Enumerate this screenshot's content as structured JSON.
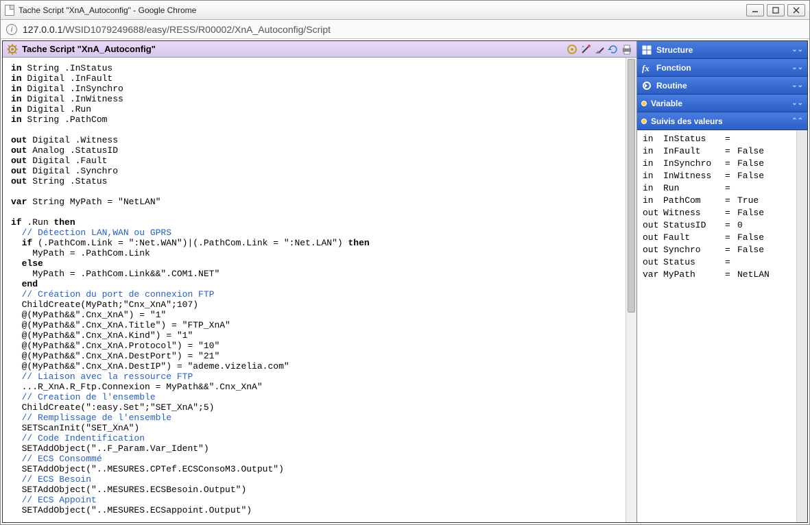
{
  "window": {
    "title": "Tache Script \"XnA_Autoconfig\" - Google Chrome"
  },
  "address": {
    "prefix": "127.0.0.1",
    "path": "/WSID1079249688/easy/RESS/R00002/XnA_Autoconfig/Script"
  },
  "header": {
    "title": "Tache Script \"XnA_Autoconfig\""
  },
  "accordion": {
    "structure": "Structure",
    "fonction": "Fonction",
    "routine": "Routine",
    "variable": "Variable",
    "suivis": "Suivis des valeurs"
  },
  "values": [
    {
      "kind": "in",
      "name": "InStatus",
      "val": ""
    },
    {
      "kind": "in",
      "name": "InFault",
      "val": "False"
    },
    {
      "kind": "in",
      "name": "InSynchro",
      "val": "False"
    },
    {
      "kind": "in",
      "name": "InWitness",
      "val": "False"
    },
    {
      "kind": "in",
      "name": "Run",
      "val": ""
    },
    {
      "kind": "in",
      "name": "PathCom",
      "val": "True"
    },
    {
      "kind": "out",
      "name": "Witness",
      "val": "False"
    },
    {
      "kind": "out",
      "name": "StatusID",
      "val": "0"
    },
    {
      "kind": "out",
      "name": "Fault",
      "val": "False"
    },
    {
      "kind": "out",
      "name": "Synchro",
      "val": "False"
    },
    {
      "kind": "out",
      "name": "Status",
      "val": ""
    },
    {
      "kind": "var",
      "name": "MyPath",
      "val": "NetLAN"
    }
  ],
  "code": {
    "l1a": "in",
    "l1b": " String .InStatus",
    "l2a": "in",
    "l2b": " Digital .InFault",
    "l3a": "in",
    "l3b": " Digital .InSynchro",
    "l4a": "in",
    "l4b": " Digital .InWitness",
    "l5a": "in",
    "l5b": " Digital .Run",
    "l6a": "in",
    "l6b": " String .PathCom",
    "blank1": "",
    "l7a": "out",
    "l7b": " Digital .Witness",
    "l8a": "out",
    "l8b": " Analog .StatusID",
    "l9a": "out",
    "l9b": " Digital .Fault",
    "l10a": "out",
    "l10b": " Digital .Synchro",
    "l11a": "out",
    "l11b": " String .Status",
    "blank2": "",
    "l12a": "var",
    "l12b": " String MyPath = \"NetLAN\"",
    "blank3": "",
    "l13a": "if",
    "l13b": " .Run ",
    "l13c": "then",
    "c1": "  // Détection LAN,WAN ou GPRS",
    "l14a": "  if",
    "l14b": " (.PathCom.Link = \":Net.WAN\")|(.PathCom.Link = \":Net.LAN\") ",
    "l14c": "then",
    "l15": "    MyPath = .PathCom.Link",
    "l16a": "  else",
    "l17": "    MyPath = .PathCom.Link&&\".COM1.NET\"",
    "l18a": "  end",
    "c2": "  // Création du port de connexion FTP",
    "l19": "  ChildCreate(MyPath;\"Cnx_XnA\";107)",
    "l20": "  @(MyPath&&\".Cnx_XnA\") = \"1\"",
    "l21": "  @(MyPath&&\".Cnx_XnA.Title\") = \"FTP_XnA\"",
    "l22": "  @(MyPath&&\".Cnx_XnA.Kind\") = \"1\"",
    "l23": "  @(MyPath&&\".Cnx_XnA.Protocol\") = \"10\"",
    "l24": "  @(MyPath&&\".Cnx_XnA.DestPort\") = \"21\"",
    "l25": "  @(MyPath&&\".Cnx_XnA.DestIP\") = \"ademe.vizelia.com\"",
    "c3": "  // Liaison avec la ressource FTP",
    "l26": "  ...R_XnA.R_Ftp.Connexion = MyPath&&\".Cnx_XnA\"",
    "c4": "  // Creation de l'ensemble",
    "l27": "  ChildCreate(\":easy.Set\";\"SET_XnA\";5)",
    "c5": "  // Remplissage de l'ensemble",
    "l28": "  SETScanInit(\"SET_XnA\")",
    "c6": "  // Code Indentification",
    "l29": "  SETAddObject(\"..F_Param.Var_Ident\")",
    "c7": "  // ECS Consommé",
    "l30": "  SETAddObject(\"..MESURES.CPTef.ECSConsoM3.Output\")",
    "c8": "  // ECS Besoin",
    "l31": "  SETAddObject(\"..MESURES.ECSBesoin.Output\")",
    "c9": "  // ECS Appoint",
    "l32": "  SETAddObject(\"..MESURES.ECSappoint.Output\")"
  }
}
